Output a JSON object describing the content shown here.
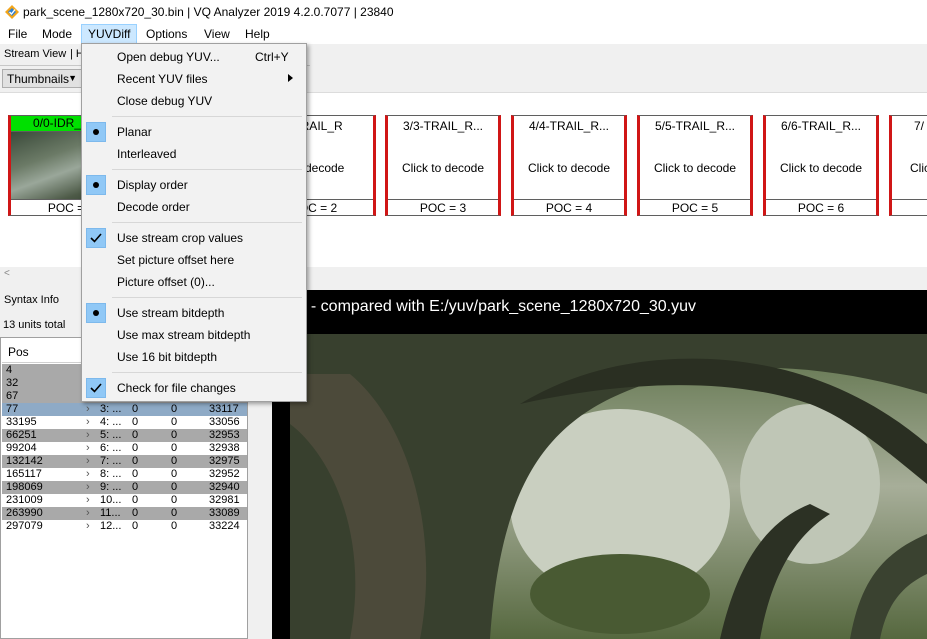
{
  "window": {
    "title": "park_scene_1280x720_30.bin | VQ Analyzer 2019 4.2.0.7077  | 23840",
    "icon": "vq-analyzer-app-icon"
  },
  "menubar": {
    "items": [
      {
        "label": "File"
      },
      {
        "label": "Mode"
      },
      {
        "label": "YUVDiff",
        "active": true
      },
      {
        "label": "Options"
      },
      {
        "label": "View"
      },
      {
        "label": "Help"
      }
    ]
  },
  "tabs": {
    "stream_view": "Stream View",
    "hidden": "| H"
  },
  "thumbnails": {
    "selector_value": "Thumbnails",
    "first": {
      "header": "0/0-IDR_W_",
      "poc": "POC ="
    },
    "items": [
      {
        "title": "TRAIL_R",
        "body": "to decode",
        "poc": "OC = 2"
      },
      {
        "title": "3/3-TRAIL_R...",
        "body": "Click to decode",
        "poc": "POC = 3"
      },
      {
        "title": "4/4-TRAIL_R...",
        "body": "Click to decode",
        "poc": "POC = 4"
      },
      {
        "title": "5/5-TRAIL_R...",
        "body": "Click to decode",
        "poc": "POC = 5"
      },
      {
        "title": "6/6-TRAIL_R...",
        "body": "Click to decode",
        "poc": "POC = 6"
      },
      {
        "title": "7/",
        "body": "Clic",
        "poc": ""
      }
    ],
    "scroll_left_glyph": "<"
  },
  "syntax": {
    "tab_label": "Syntax Info",
    "units_total": "13 units total",
    "column_header": "Pos",
    "rows": [
      {
        "pos": "4",
        "a": "",
        "b": "",
        "c": "",
        "d": ""
      },
      {
        "pos": "32",
        "a": "",
        "b": "",
        "c": "",
        "d": ""
      },
      {
        "pos": "67",
        "a": "",
        "b": "",
        "c": "",
        "d": ""
      },
      {
        "pos": "77",
        "a": "3: ...",
        "b": "0",
        "c": "0",
        "d": "33117"
      },
      {
        "pos": "33195",
        "a": "4: ...",
        "b": "0",
        "c": "0",
        "d": "33056"
      },
      {
        "pos": "66251",
        "a": "5: ...",
        "b": "0",
        "c": "0",
        "d": "32953"
      },
      {
        "pos": "99204",
        "a": "6: ...",
        "b": "0",
        "c": "0",
        "d": "32938"
      },
      {
        "pos": "132142",
        "a": "7: ...",
        "b": "0",
        "c": "0",
        "d": "32975"
      },
      {
        "pos": "165117",
        "a": "8: ...",
        "b": "0",
        "c": "0",
        "d": "32952"
      },
      {
        "pos": "198069",
        "a": "9: ...",
        "b": "0",
        "c": "0",
        "d": "32940"
      },
      {
        "pos": "231009",
        "a": "10...",
        "b": "0",
        "c": "0",
        "d": "32981"
      },
      {
        "pos": "263990",
        "a": "11...",
        "b": "0",
        "c": "0",
        "d": "33089"
      },
      {
        "pos": "297079",
        "a": "12...",
        "b": "0",
        "c": "0",
        "d": "33224"
      }
    ]
  },
  "video": {
    "caption": "/ - compared with E:/yuv/park_scene_1280x720_30.yuv"
  },
  "dropdown": {
    "items": [
      {
        "label": "Open debug YUV...",
        "shortcut": "Ctrl+Y"
      },
      {
        "label": "Recent YUV files",
        "submenu": true
      },
      {
        "label": "Close debug YUV"
      },
      {
        "label": "Planar",
        "mark": "radio"
      },
      {
        "label": "Interleaved"
      },
      {
        "label": "Display order",
        "mark": "radio"
      },
      {
        "label": "Decode order"
      },
      {
        "label": "Use stream crop values",
        "mark": "check"
      },
      {
        "label": "Set picture offset here"
      },
      {
        "label": "Picture offset (0)..."
      },
      {
        "label": "Use stream bitdepth",
        "mark": "radio"
      },
      {
        "label": "Use max stream bitdepth"
      },
      {
        "label": "Use 16 bit bitdepth"
      },
      {
        "label": "Check for file changes",
        "mark": "check"
      }
    ]
  },
  "colors": {
    "menu_highlight": "#cce8ff",
    "check_highlight": "#90c8f6",
    "thumb_border": "#d01616",
    "idr_header": "#00e000",
    "row_shade": "#a9a9a9",
    "row_selected": "#8eaac6"
  }
}
